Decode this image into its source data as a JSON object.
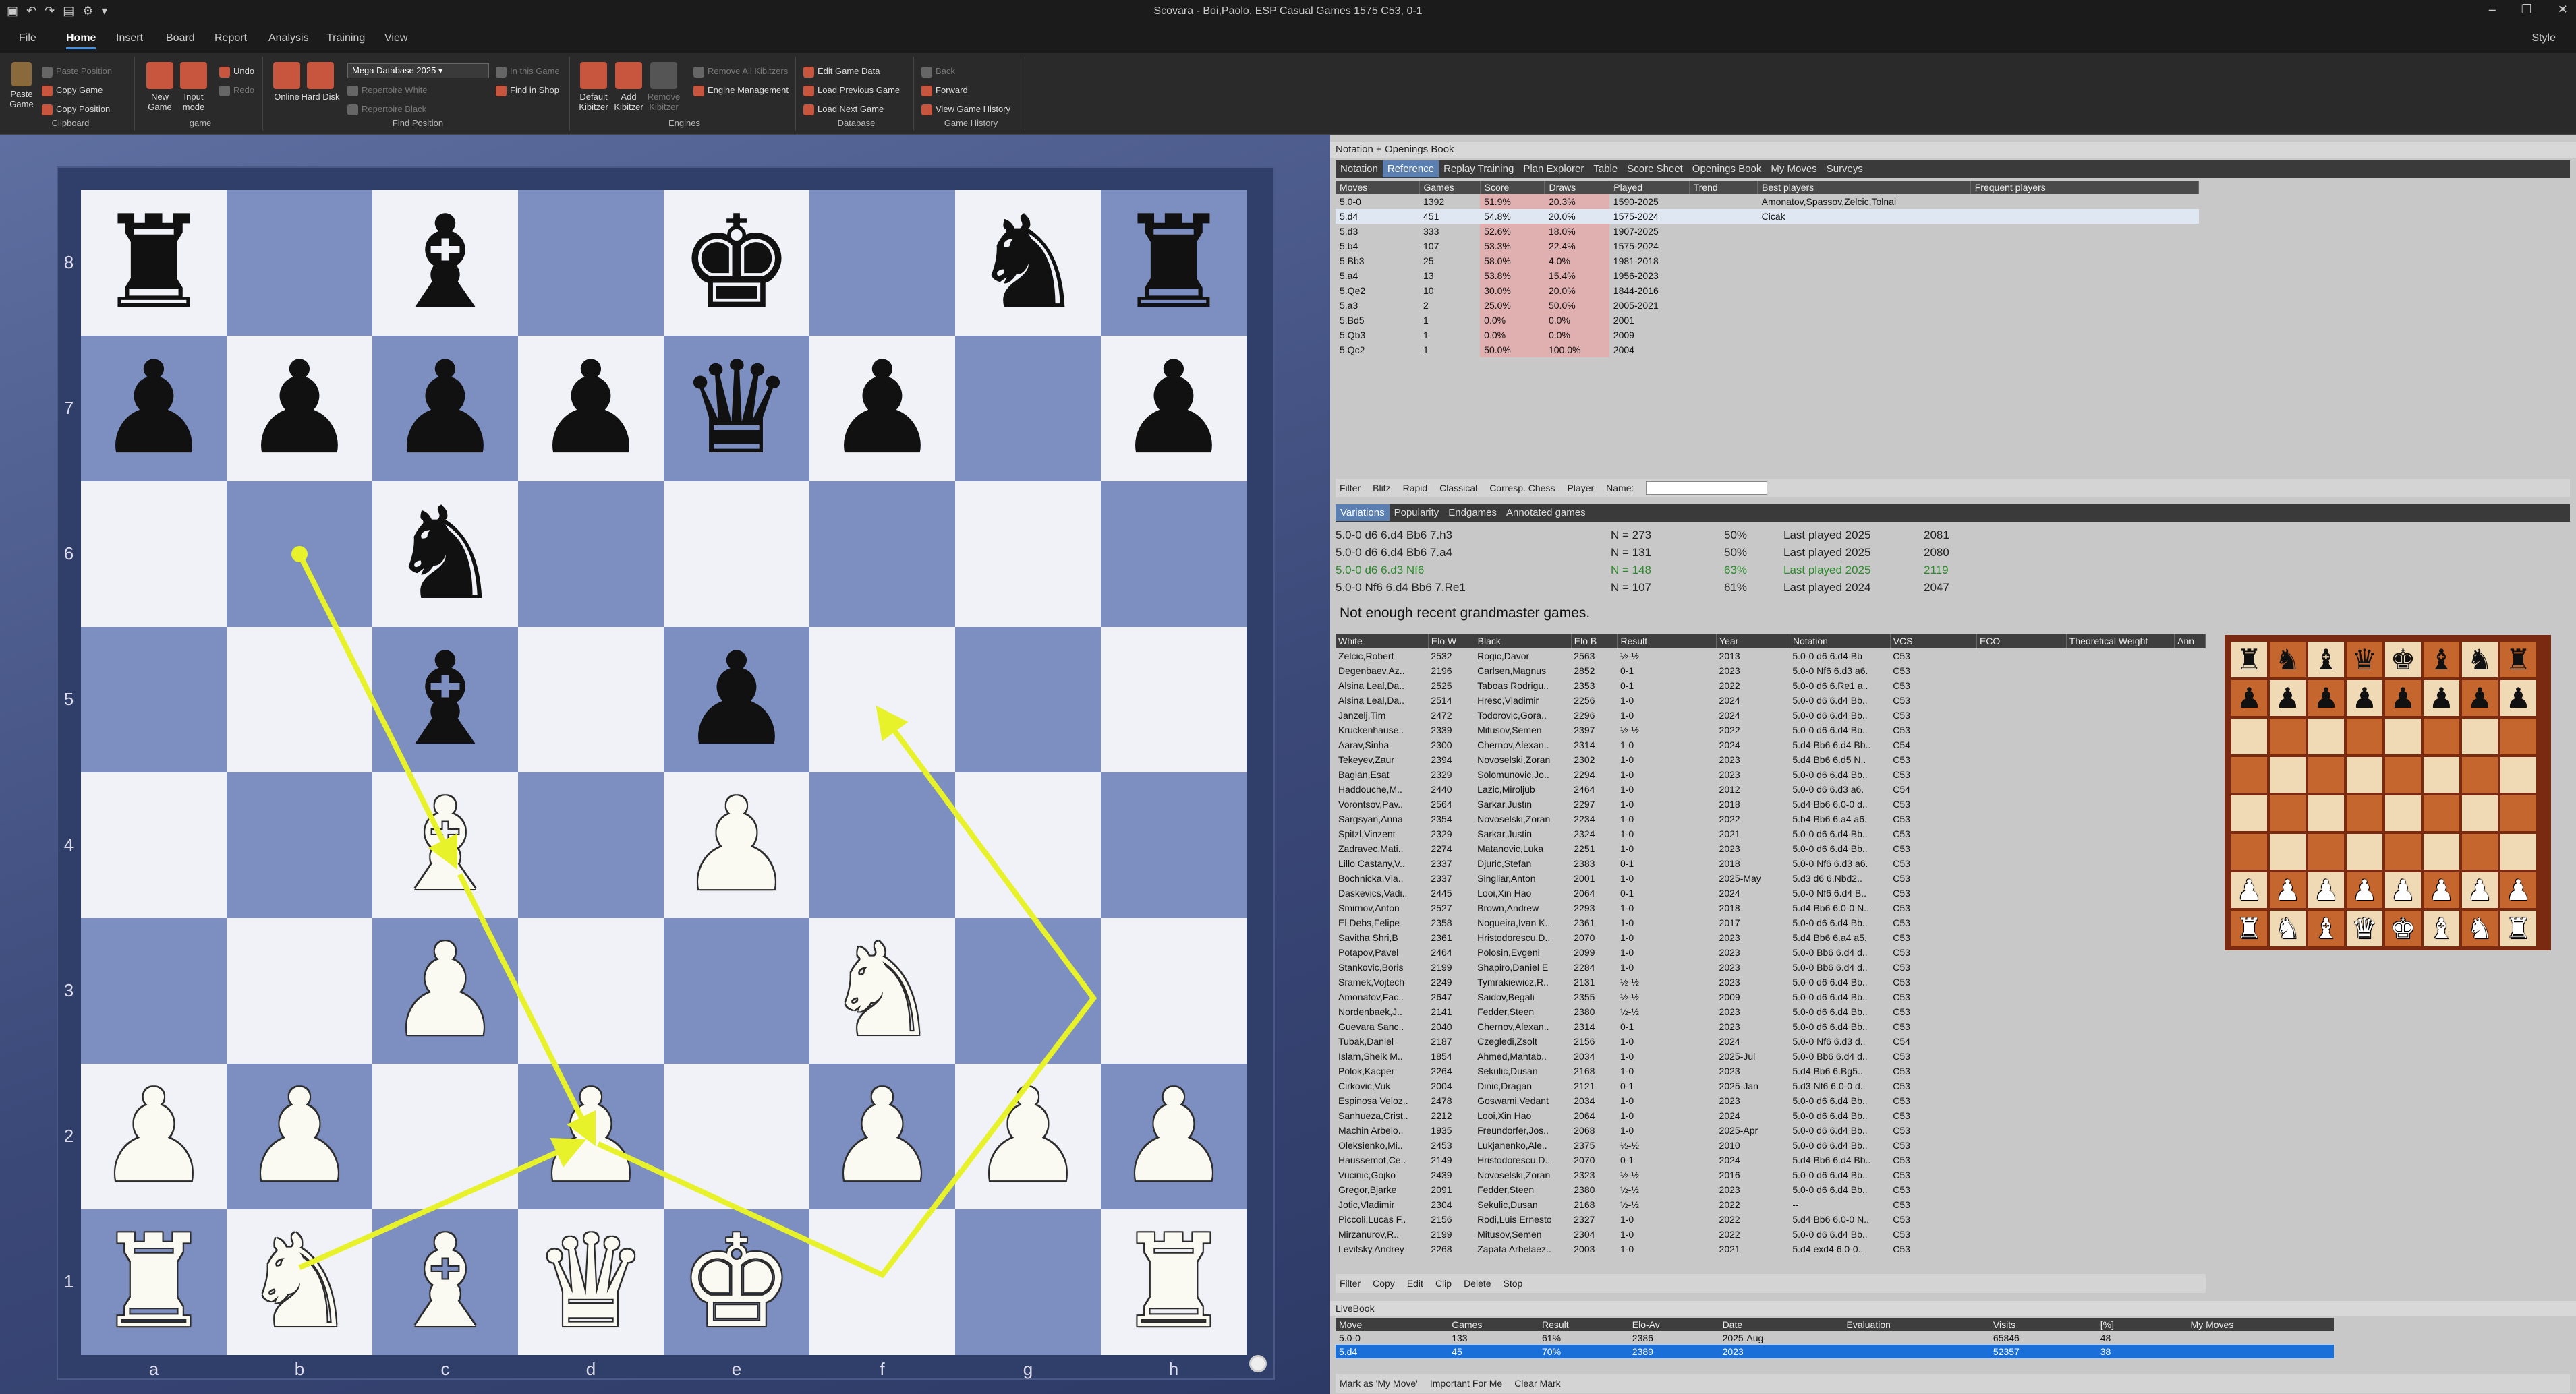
{
  "window": {
    "title": "Scovara - Boi,Paolo. ESP Casual Games 1575  C53, 0-1",
    "style_label": "Style"
  },
  "tabs": [
    "File",
    "Home",
    "Insert",
    "Board",
    "Report",
    "Analysis",
    "Training",
    "View"
  ],
  "active_tab": "Home",
  "ribbon": {
    "clipboard": {
      "paste_game": "Paste Game",
      "paste_position": "Paste Position",
      "copy_game": "Copy Game",
      "copy_position": "Copy Position",
      "caption": "Clipboard"
    },
    "game": {
      "new_game": "New Game",
      "input_mode": "Input mode",
      "undo": "Undo",
      "redo": "Redo",
      "caption": "game"
    },
    "find": {
      "online": "Online",
      "hard_disk": "Hard Disk",
      "database": "Mega Database 2025",
      "repertoire_white": "Repertoire White",
      "repertoire_black": "Repertoire Black",
      "in_this_game": "In this Game",
      "find_in_shop": "Find in Shop",
      "caption": "Find Position"
    },
    "engines": {
      "default_kibitzer": "Default Kibitzer",
      "add_kibitzer": "Add Kibitzer",
      "remove_kibitzer": "Remove Kibitzer",
      "remove_all": "Remove All Kibitzers",
      "engine_mgmt": "Engine Management",
      "caption": "Engines"
    },
    "database": {
      "edit_game_data": "Edit Game Data",
      "load_previous": "Load Previous Game",
      "load_next": "Load Next Game",
      "caption": "Database"
    },
    "history": {
      "back": "Back",
      "forward": "Forward",
      "view_history": "View Game History",
      "caption": "Game History"
    }
  },
  "board": {
    "ranks": [
      "8",
      "7",
      "6",
      "5",
      "4",
      "3",
      "2",
      "1"
    ],
    "files": [
      "a",
      "b",
      "c",
      "d",
      "e",
      "f",
      "g",
      "h"
    ],
    "pieces": [
      [
        "br",
        "",
        "bb",
        "",
        "bk",
        "",
        "bn",
        "br"
      ],
      [
        "bp",
        "bp",
        "bp",
        "bp",
        "bq",
        "bp",
        "",
        "bp"
      ],
      [
        "",
        "",
        "bn",
        "",
        "",
        "",
        "",
        ""
      ],
      [
        "",
        "",
        "bb",
        "",
        "bp",
        "",
        "",
        ""
      ],
      [
        "",
        "",
        "wb",
        "",
        "wp",
        "",
        "",
        ""
      ],
      [
        "",
        "",
        "wp",
        "",
        "",
        "wn",
        "",
        ""
      ],
      [
        "wp",
        "wp",
        "",
        "wp",
        "",
        "wp",
        "wp",
        "wp"
      ],
      [
        "wr",
        "wn",
        "wb",
        "wq",
        "wk",
        "",
        "",
        "wr"
      ]
    ]
  },
  "notation_header": "Notation + Openings Book",
  "notation_tabs": [
    "Notation",
    "Reference",
    "Replay Training",
    "Plan Explorer",
    "Table",
    "Score Sheet",
    "Openings Book",
    "My Moves",
    "Surveys"
  ],
  "active_notation_tab": "Reference",
  "reference": {
    "columns": [
      "Moves",
      "Games",
      "Score",
      "Draws",
      "Played",
      "Trend",
      "Best players",
      "Frequent players"
    ],
    "rows": [
      [
        "5.0-0",
        "1392",
        "51.9%",
        "20.3%",
        "1590-2025",
        "",
        "Amonatov,Spassov,Zelcic,Tolnai",
        ""
      ],
      [
        "5.d4",
        "451",
        "54.8%",
        "20.0%",
        "1575-2024",
        "",
        "Cicak",
        ""
      ],
      [
        "5.d3",
        "333",
        "52.6%",
        "18.0%",
        "1907-2025",
        "",
        "",
        ""
      ],
      [
        "5.b4",
        "107",
        "53.3%",
        "22.4%",
        "1575-2024",
        "",
        "",
        ""
      ],
      [
        "5.Bb3",
        "25",
        "58.0%",
        "4.0%",
        "1981-2018",
        "",
        "",
        ""
      ],
      [
        "5.a4",
        "13",
        "53.8%",
        "15.4%",
        "1956-2023",
        "",
        "",
        ""
      ],
      [
        "5.Qe2",
        "10",
        "30.0%",
        "20.0%",
        "1844-2016",
        "",
        "",
        ""
      ],
      [
        "5.a3",
        "2",
        "25.0%",
        "50.0%",
        "2005-2021",
        "",
        "",
        ""
      ],
      [
        "5.Bd5",
        "1",
        "0.0%",
        "0.0%",
        "2001",
        "",
        "",
        ""
      ],
      [
        "5.Qb3",
        "1",
        "0.0%",
        "0.0%",
        "2009",
        "",
        "",
        ""
      ],
      [
        "5.Qc2",
        "1",
        "50.0%",
        "100.0%",
        "2004",
        "",
        "",
        ""
      ]
    ]
  },
  "filter_bar": [
    "Filter",
    "Blitz",
    "Rapid",
    "Classical",
    "Corresp. Chess",
    "Player",
    "Name:"
  ],
  "lower_tabs": [
    "Variations",
    "Popularity",
    "Endgames",
    "Annotated games"
  ],
  "variations": [
    {
      "line": "5.0-0 d6 6.d4 Bb6 7.h3",
      "n": "N = 273",
      "score": "50%",
      "played": "Last played 2025",
      "elo": "2081"
    },
    {
      "line": "5.0-0 d6 6.d4 Bb6 7.a4",
      "n": "N = 131",
      "score": "50%",
      "played": "Last played 2025",
      "elo": "2080"
    },
    {
      "line": "5.0-0 d6 6.d3 Nf6",
      "n": "N = 148",
      "score": "63%",
      "played": "Last played 2025",
      "elo": "2119"
    },
    {
      "line": "5.0-0 Nf6 6.d4 Bb6 7.Re1",
      "n": "N = 107",
      "score": "61%",
      "played": "Last played 2024",
      "elo": "2047"
    }
  ],
  "gm_notice": "Not enough recent grandmaster games.",
  "games_columns": [
    "White",
    "Elo W",
    "Black",
    "Elo B",
    "Result",
    "Year",
    "Notation",
    "VCS",
    "ECO",
    "Theoretical Weight",
    "Ann"
  ],
  "games": [
    [
      "Zelcic,Robert",
      "2532",
      "Rogic,Davor",
      "2563",
      "½-½",
      "2013",
      "5.0-0 d6 6.d4 Bb",
      "C53"
    ],
    [
      "Degenbaev,Az..",
      "2196",
      "Carlsen,Magnus",
      "2852",
      "0-1",
      "2023",
      "5.0-0 Nf6 6.d3 a6.",
      "C53"
    ],
    [
      "Alsina Leal,Da..",
      "2525",
      "Taboas Rodrigu..",
      "2353",
      "0-1",
      "2022",
      "5.0-0 d6 6.Re1 a..",
      "C53"
    ],
    [
      "Alsina Leal,Da..",
      "2514",
      "Hresc,Vladimir",
      "2256",
      "1-0",
      "2024",
      "5.0-0 d6 6.d4 Bb..",
      "C53"
    ],
    [
      "Janzelj,Tim",
      "2472",
      "Todorovic,Gora..",
      "2296",
      "1-0",
      "2024",
      "5.0-0 d6 6.d4 Bb..",
      "C53"
    ],
    [
      "Kruckenhause..",
      "2339",
      "Mitusov,Semen",
      "2397",
      "½-½",
      "2022",
      "5.0-0 d6 6.d4 Bb..",
      "C53"
    ],
    [
      "Aarav,Sinha",
      "2300",
      "Chernov,Alexan..",
      "2314",
      "1-0",
      "2024",
      "5.d4 Bb6 6.d4 Bb..",
      "C54"
    ],
    [
      "Tekeyev,Zaur",
      "2394",
      "Novoselski,Zoran",
      "2302",
      "1-0",
      "2023",
      "5.d4 Bb6 6.d5 N..",
      "C53"
    ],
    [
      "Baglan,Esat",
      "2329",
      "Solomunovic,Jo..",
      "2294",
      "1-0",
      "2023",
      "5.0-0 d6 6.d4 Bb..",
      "C53"
    ],
    [
      "Haddouche,M..",
      "2440",
      "Lazic,Miroljub",
      "2464",
      "1-0",
      "2012",
      "5.0-0 d6 6.d3 a6.",
      "C54"
    ],
    [
      "Vorontsov,Pav..",
      "2564",
      "Sarkar,Justin",
      "2297",
      "1-0",
      "2018",
      "5.d4 Bb6 6.0-0 d..",
      "C53"
    ],
    [
      "Sargsyan,Anna",
      "2354",
      "Novoselski,Zoran",
      "2234",
      "1-0",
      "2022",
      "5.b4 Bb6 6.a4 a6.",
      "C53"
    ],
    [
      "Spitzl,Vinzent",
      "2329",
      "Sarkar,Justin",
      "2324",
      "1-0",
      "2021",
      "5.0-0 d6 6.d4 Bb..",
      "C53"
    ],
    [
      "Zadravec,Mati..",
      "2274",
      "Matanovic,Luka",
      "2251",
      "1-0",
      "2023",
      "5.0-0 d6 6.d4 Bb..",
      "C53"
    ],
    [
      "Lillo Castany,V..",
      "2337",
      "Djuric,Stefan",
      "2383",
      "0-1",
      "2018",
      "5.0-0 Nf6 6.d3 a6.",
      "C53"
    ],
    [
      "Bochnicka,Vla..",
      "2337",
      "Singliar,Anton",
      "2001",
      "1-0",
      "2025-May",
      "5.d3 d6 6.Nbd2..",
      "C53"
    ],
    [
      "Daskevics,Vadi..",
      "2445",
      "Looi,Xin Hao",
      "2064",
      "0-1",
      "2024",
      "5.0-0 Nf6 6.d4 B..",
      "C53"
    ],
    [
      "Smirnov,Anton",
      "2527",
      "Brown,Andrew",
      "2293",
      "1-0",
      "2018",
      "5.d4 Bb6 6.0-0 N..",
      "C53"
    ],
    [
      "El Debs,Felipe",
      "2358",
      "Nogueira,Ivan K..",
      "2361",
      "1-0",
      "2017",
      "5.0-0 d6 6.d4 Bb..",
      "C53"
    ],
    [
      "Savitha Shri,B",
      "2361",
      "Hristodorescu,D..",
      "2070",
      "1-0",
      "2023",
      "5.d4 Bb6 6.a4 a5.",
      "C53"
    ],
    [
      "Potapov,Pavel",
      "2464",
      "Polosin,Evgeni",
      "2099",
      "1-0",
      "2023",
      "5.0-0 Bb6 6.d4 d..",
      "C53"
    ],
    [
      "Stankovic,Boris",
      "2199",
      "Shapiro,Daniel E",
      "2284",
      "1-0",
      "2023",
      "5.0-0 Bb6 6.d4 d..",
      "C53"
    ],
    [
      "Sramek,Vojtech",
      "2249",
      "Tymrakiewicz,R..",
      "2131",
      "½-½",
      "2023",
      "5.0-0 d6 6.d4 Bb..",
      "C53"
    ],
    [
      "Amonatov,Fac..",
      "2647",
      "Saidov,Begali",
      "2355",
      "½-½",
      "2009",
      "5.0-0 d6 6.d4 Bb..",
      "C53"
    ],
    [
      "Nordenbaek,J..",
      "2141",
      "Fedder,Steen",
      "2380",
      "½-½",
      "2023",
      "5.0-0 d6 6.d4 Bb..",
      "C53"
    ],
    [
      "Guevara Sanc..",
      "2040",
      "Chernov,Alexan..",
      "2314",
      "0-1",
      "2023",
      "5.0-0 d6 6.d4 Bb..",
      "C53"
    ],
    [
      "Tubak,Daniel",
      "2187",
      "Czegledi,Zsolt",
      "2156",
      "1-0",
      "2024",
      "5.0-0 Nf6 6.d3 d..",
      "C54"
    ],
    [
      "Islam,Sheik M..",
      "1854",
      "Ahmed,Mahtab..",
      "2034",
      "1-0",
      "2025-Jul",
      "5.0-0 Bb6 6.d4 d..",
      "C53"
    ],
    [
      "Polok,Kacper",
      "2264",
      "Sekulic,Dusan",
      "2168",
      "1-0",
      "2023",
      "5.d4 Bb6 6.Bg5..",
      "C53"
    ],
    [
      "Cirkovic,Vuk",
      "2004",
      "Dinic,Dragan",
      "2121",
      "0-1",
      "2025-Jan",
      "5.d3 Nf6 6.0-0 d..",
      "C53"
    ],
    [
      "Espinosa Veloz..",
      "2478",
      "Goswami,Vedant",
      "2034",
      "1-0",
      "2023",
      "5.0-0 d6 6.d4 Bb..",
      "C53"
    ],
    [
      "Sanhueza,Crist..",
      "2212",
      "Looi,Xin Hao",
      "2064",
      "1-0",
      "2024",
      "5.0-0 d6 6.d4 Bb..",
      "C53"
    ],
    [
      "Machin Arbelo..",
      "1935",
      "Freundorfer,Jos..",
      "2068",
      "1-0",
      "2025-Apr",
      "5.0-0 d6 6.d4 Bb..",
      "C53"
    ],
    [
      "Oleksienko,Mi..",
      "2453",
      "Lukjanenko,Ale..",
      "2375",
      "½-½",
      "2010",
      "5.0-0 d6 6.d4 Bb..",
      "C53"
    ],
    [
      "Haussemot,Ce..",
      "2149",
      "Hristodorescu,D..",
      "2070",
      "0-1",
      "2024",
      "5.d4 Bb6 6.d4 Bb..",
      "C53"
    ],
    [
      "Vucinic,Gojko",
      "2439",
      "Novoselski,Zoran",
      "2323",
      "½-½",
      "2016",
      "5.0-0 d6 6.d4 Bb..",
      "C53"
    ],
    [
      "Gregor,Bjarke",
      "2091",
      "Fedder,Steen",
      "2380",
      "½-½",
      "2023",
      "5.0-0 d6 6.d4 Bb..",
      "C53"
    ],
    [
      "Jotic,Vladimir",
      "2304",
      "Sekulic,Dusan",
      "2168",
      "½-½",
      "2022",
      "--",
      "C53"
    ],
    [
      "Piccoli,Lucas F..",
      "2156",
      "Rodi,Luis Ernesto",
      "2327",
      "1-0",
      "2022",
      "5.d4 Bb6 6.0-0 N..",
      "C53"
    ],
    [
      "Mirzanurov,R..",
      "2199",
      "Mitusov,Semen",
      "2304",
      "1-0",
      "2022",
      "5.0-0 d6 6.d4 Bb..",
      "C53"
    ],
    [
      "Levitsky,Andrey",
      "2268",
      "Zapata Arbelaez..",
      "2003",
      "1-0",
      "2021",
      "5.d4 exd4 6.0-0..",
      "C53"
    ]
  ],
  "games_toolbar": [
    "Filter",
    "Copy",
    "Edit",
    "Clip",
    "Delete",
    "Stop"
  ],
  "livebook": {
    "header": "LiveBook",
    "columns": [
      "Move",
      "Games",
      "Result",
      "Elo-Av",
      "Date",
      "Evaluation",
      "Visits",
      "[%]",
      "My Moves"
    ],
    "rows": [
      [
        "5.0-0",
        "133",
        "61%",
        "2386",
        "2025-Aug",
        "",
        "65846",
        "48",
        ""
      ],
      [
        "5.d4",
        "45",
        "70%",
        "2389",
        "2023",
        "",
        "52357",
        "38",
        ""
      ]
    ],
    "toolbar": [
      "Mark as 'My Move'",
      "Important For Me",
      "Clear Mark"
    ]
  },
  "mini_board": [
    [
      "br",
      "bn",
      "bb",
      "bq",
      "bk",
      "bb",
      "bn",
      "br"
    ],
    [
      "bp",
      "bp",
      "bp",
      "bp",
      "bp",
      "bp",
      "bp",
      "bp"
    ],
    [
      "",
      "",
      "",
      "",
      "",
      "",
      "",
      ""
    ],
    [
      "",
      "",
      "",
      "",
      "",
      "",
      "",
      ""
    ],
    [
      "",
      "",
      "",
      "",
      "",
      "",
      "",
      ""
    ],
    [
      "",
      "",
      "",
      "",
      "",
      "",
      "",
      ""
    ],
    [
      "wp",
      "wp",
      "wp",
      "wp",
      "wp",
      "wp",
      "wp",
      "wp"
    ],
    [
      "wr",
      "wn",
      "wb",
      "wq",
      "wk",
      "wb",
      "wn",
      "wr"
    ]
  ],
  "colors": {
    "arrow": "#e8f22a",
    "board_light": "#f0f2f7",
    "board_dark": "#7d8ec0",
    "selection": "#1a6fd8"
  }
}
